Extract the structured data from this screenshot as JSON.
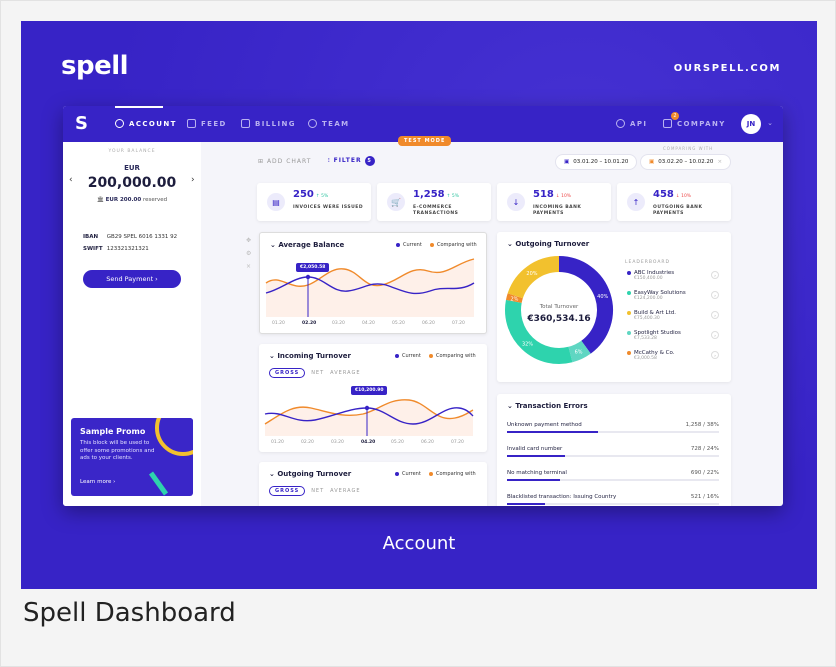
{
  "brand": {
    "logo": "spell",
    "url": "OURSPELL.COM"
  },
  "caption": "Account",
  "footer_title": "Spell Dashboard",
  "nav": {
    "logo": "S",
    "items": [
      {
        "label": "ACCOUNT",
        "icon": "clock-icon",
        "active": true
      },
      {
        "label": "FEED",
        "icon": "feed-icon",
        "active": false
      },
      {
        "label": "BILLING",
        "icon": "billing-icon",
        "active": false
      },
      {
        "label": "TEAM",
        "icon": "team-icon",
        "active": false
      }
    ],
    "api_label": "API",
    "company_label": "COMPANY",
    "company_badge": "2",
    "avatar": "JN",
    "test_mode": "TEST MODE"
  },
  "balance": {
    "label": "YOUR BALANCE",
    "currency": "EUR",
    "amount": "200,000.00",
    "reserved_amount": "EUR 200.00",
    "reserved_suffix": "reserved",
    "iban_label": "IBAN",
    "iban": "GB29 SPEL 6016 1331 92",
    "swift_label": "SWIFT",
    "swift": "123321321321",
    "send_button": "Send Payment  ›"
  },
  "promo": {
    "title": "Sample Promo",
    "text": "This block will be used to offer some promotions and ads to your clients.",
    "link": "Learn more  ›"
  },
  "toolbar": {
    "add_chart": "ADD CHART",
    "filter": "FILTER",
    "filter_count": "5",
    "date_range": "03.01.20 – 10.01.20",
    "comparing_label": "COMPARING WITH",
    "compare_range": "03.02.20 – 10.02.20"
  },
  "kpis": [
    {
      "value": "250",
      "delta": "↑ 5%",
      "delta_color": "#2ec4a0",
      "label": "INVOICES WERE ISSUED",
      "icon": "document-icon"
    },
    {
      "value": "1,258",
      "delta": "↑ 5%",
      "delta_color": "#2ec4a0",
      "label": "E-COMMERCE TRANSACTIONS",
      "icon": "cart-icon"
    },
    {
      "value": "518",
      "delta": "↓ 10%",
      "delta_color": "#ee4b4b",
      "label": "INCOMING BANK PAYMENTS",
      "icon": "arrow-down-icon"
    },
    {
      "value": "458",
      "delta": "↓ 10%",
      "delta_color": "#ee4b4b",
      "label": "OUTGOING BANK PAYMENTS",
      "icon": "arrow-up-icon"
    }
  ],
  "legend": {
    "current": "Current",
    "comparing": "Comparing with",
    "current_color": "#3723c6",
    "comparing_color": "#f08a2b"
  },
  "avg_balance": {
    "title": "Average Balance",
    "tooltip": "€2,050.58",
    "xticks": [
      "01.20",
      "02.20",
      "03.20",
      "04.20",
      "05.20",
      "06.20",
      "07.20"
    ]
  },
  "incoming": {
    "title": "Incoming Turnover",
    "tabs": [
      "GROSS",
      "NET",
      "AVERAGE"
    ],
    "tooltip": "€10,200.90",
    "xticks": [
      "01.20",
      "02.20",
      "03.20",
      "04.20",
      "05.20",
      "06.20",
      "07.20"
    ]
  },
  "outgoing_small": {
    "title": "Outgoing Turnover",
    "tabs": [
      "GROSS",
      "NET",
      "AVERAGE"
    ]
  },
  "outgoing": {
    "title": "Outgoing Turnover",
    "center_label": "Total Turnover",
    "center_value": "€360,534.16",
    "leaderboard_title": "LEADERBOARD",
    "slices": [
      {
        "label": "40%",
        "value": 40,
        "color": "#3723c6"
      },
      {
        "label": "6%",
        "value": 6,
        "color": "#5fd6c2"
      },
      {
        "label": "32%",
        "value": 32,
        "color": "#2ed3ad"
      },
      {
        "label": "2%",
        "value": 2,
        "color": "#f08a2b"
      },
      {
        "label": "20%",
        "value": 20,
        "color": "#f2c12e"
      }
    ],
    "leaders": [
      {
        "name": "ABC Industries",
        "amount": "€150,400.00",
        "color": "#3723c6"
      },
      {
        "name": "EasyWay Solutions",
        "amount": "€124,200.00",
        "color": "#2ed3ad"
      },
      {
        "name": "Build & Art Ltd.",
        "amount": "€75,400.30",
        "color": "#f2c12e"
      },
      {
        "name": "Spotlight Studios",
        "amount": "€7,533.28",
        "color": "#5fd6c2"
      },
      {
        "name": "McCathy & Co.",
        "amount": "€3,000.58",
        "color": "#f08a2b"
      }
    ]
  },
  "errors": {
    "title": "Transaction Errors",
    "rows": [
      {
        "label": "Unknown payment method",
        "value": "1,258 / 38%",
        "pct": 38
      },
      {
        "label": "Invalid card number",
        "value": "728 / 24%",
        "pct": 24
      },
      {
        "label": "No matching terminal",
        "value": "690 / 22%",
        "pct": 22
      },
      {
        "label": "Blacklisted transaction: Issuing Country",
        "value": "521 / 16%",
        "pct": 16
      }
    ]
  }
}
